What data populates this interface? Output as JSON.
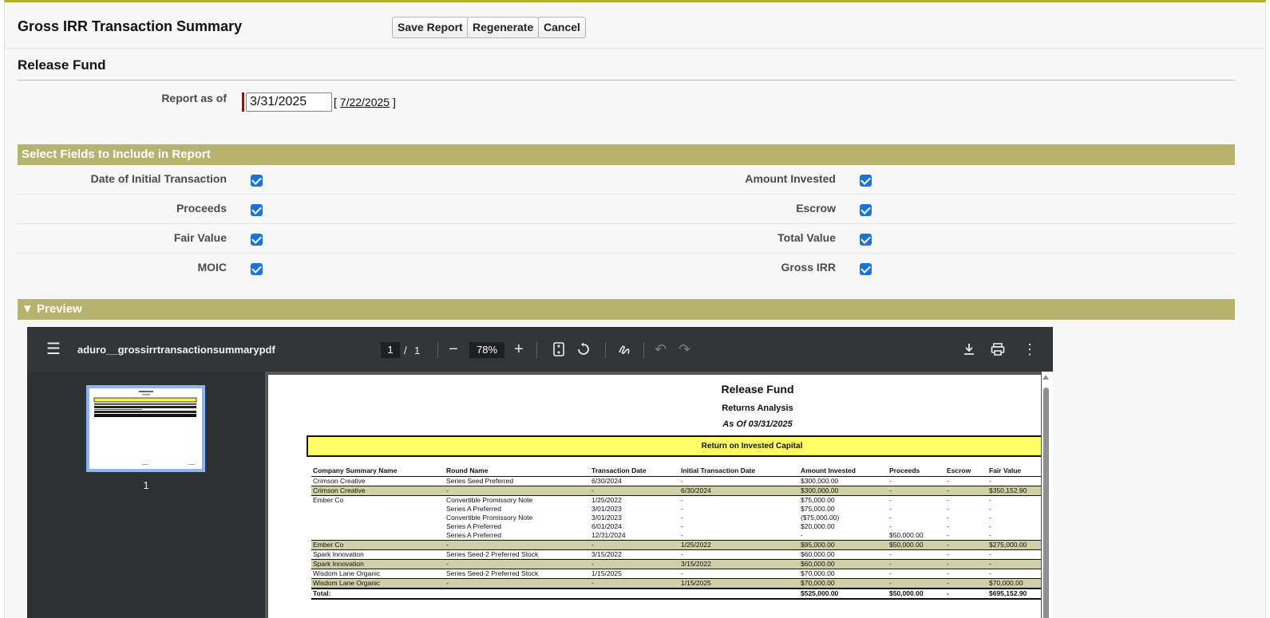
{
  "header": {
    "title": "Gross IRR Transaction Summary",
    "save_label": "Save Report",
    "regenerate_label": "Regenerate",
    "cancel_label": "Cancel"
  },
  "section": {
    "title": "Release Fund"
  },
  "report_as_of": {
    "label": "Report as of",
    "value": "3/31/2025",
    "today_open": "[",
    "today_link": "7/22/2025",
    "today_close": "]"
  },
  "fields_section": {
    "title": "Select Fields to Include in Report",
    "fields": [
      {
        "label": "Date of Initial Transaction",
        "checked": true
      },
      {
        "label": "Amount Invested",
        "checked": true
      },
      {
        "label": "Proceeds",
        "checked": true
      },
      {
        "label": "Escrow",
        "checked": true
      },
      {
        "label": "Fair Value",
        "checked": true
      },
      {
        "label": "Total Value",
        "checked": true
      },
      {
        "label": "MOIC",
        "checked": true
      },
      {
        "label": "Gross IRR",
        "checked": true
      }
    ]
  },
  "preview": {
    "title": "▼ Preview",
    "viewer": {
      "filename": "aduro__grossirrtransactionsummarypdf",
      "current_page": "1",
      "page_separator": "/",
      "total_pages": "1",
      "zoom": "78%",
      "thumbnail_label": "1"
    },
    "document": {
      "title": "Release Fund",
      "subtitle": "Returns Analysis",
      "as_of": "As Of 03/31/2025",
      "banner": "Return on Invested Capital",
      "columns": [
        "Company Summary Name",
        "Round Name",
        "Transaction Date",
        "Initial Transaction Date",
        "Amount Invested",
        "Proceeds",
        "Escrow",
        "Fair Value"
      ],
      "rows": [
        {
          "type": "detail",
          "cells": [
            "Crimson Creative",
            "Series Seed Preferred",
            "6/30/2024",
            "-",
            "$300,000.00",
            "-",
            "-",
            "-"
          ]
        },
        {
          "type": "summary",
          "cells": [
            "Crimson Creative",
            "-",
            "-",
            "6/30/2024",
            "$300,000.00",
            "-",
            "-",
            "$350,152.90"
          ]
        },
        {
          "type": "detail",
          "cells": [
            "Ember Co",
            "Convertible Promissory Note",
            "1/25/2022",
            "-",
            "$75,000.00",
            "-",
            "-",
            "-"
          ]
        },
        {
          "type": "detail",
          "cells": [
            "",
            "Series A Preferred",
            "3/01/2023",
            "-",
            "$75,000.00",
            "-",
            "-",
            "-"
          ]
        },
        {
          "type": "detail",
          "cells": [
            "",
            "Convertible Promissory Note",
            "3/01/2023",
            "-",
            "($75,000.00)",
            "-",
            "-",
            "-"
          ]
        },
        {
          "type": "detail",
          "cells": [
            "",
            "Series A Preferred",
            "6/01/2024",
            "-",
            "$20,000.00",
            "-",
            "-",
            "-"
          ]
        },
        {
          "type": "detail",
          "cells": [
            "",
            "Series A Preferred",
            "12/31/2024",
            "-",
            "-",
            "$50,000.00",
            "-",
            "-"
          ]
        },
        {
          "type": "summary",
          "cells": [
            "Ember Co",
            "-",
            "-",
            "1/25/2022",
            "$95,000.00",
            "$50,000.00",
            "-",
            "$275,000.00"
          ]
        },
        {
          "type": "detail",
          "cells": [
            "Spark Innovation",
            "Series Seed-2 Preferred Stock",
            "3/15/2022",
            "-",
            "$60,000.00",
            "-",
            "-",
            "-"
          ]
        },
        {
          "type": "summary",
          "cells": [
            "Spark Innovation",
            "-",
            "-",
            "3/15/2022",
            "$60,000.00",
            "-",
            "-",
            "-"
          ]
        },
        {
          "type": "detail",
          "cells": [
            "Wisdom Lane Organic",
            "Series Seed-2 Preferred Stock",
            "1/15/2025",
            "-",
            "$70,000.00",
            "-",
            "-",
            "-"
          ]
        },
        {
          "type": "summary",
          "cells": [
            "Wisdom Lane Organic",
            "-",
            "-",
            "1/15/2025",
            "$70,000.00",
            "-",
            "-",
            "$70,000.00"
          ]
        },
        {
          "type": "total",
          "cells": [
            "Total:",
            "",
            "",
            "",
            "$525,000.00",
            "$50,000.00",
            "-",
            "$695,152.90"
          ]
        }
      ]
    }
  },
  "colors": {
    "accent_bar": "#b5b36e",
    "top_border": "#b3ad2e",
    "checkbox": "#1a73d8",
    "required_marker": "#c00000",
    "banner_yellow": "#ffff66",
    "summary_row": "#cfcfa8"
  },
  "icons": [
    "menu-icon",
    "zoom-out-icon",
    "zoom-in-icon",
    "fit-page-icon",
    "rotate-icon",
    "annotate-icon",
    "undo-icon",
    "redo-icon",
    "download-icon",
    "print-icon",
    "more-icon"
  ]
}
